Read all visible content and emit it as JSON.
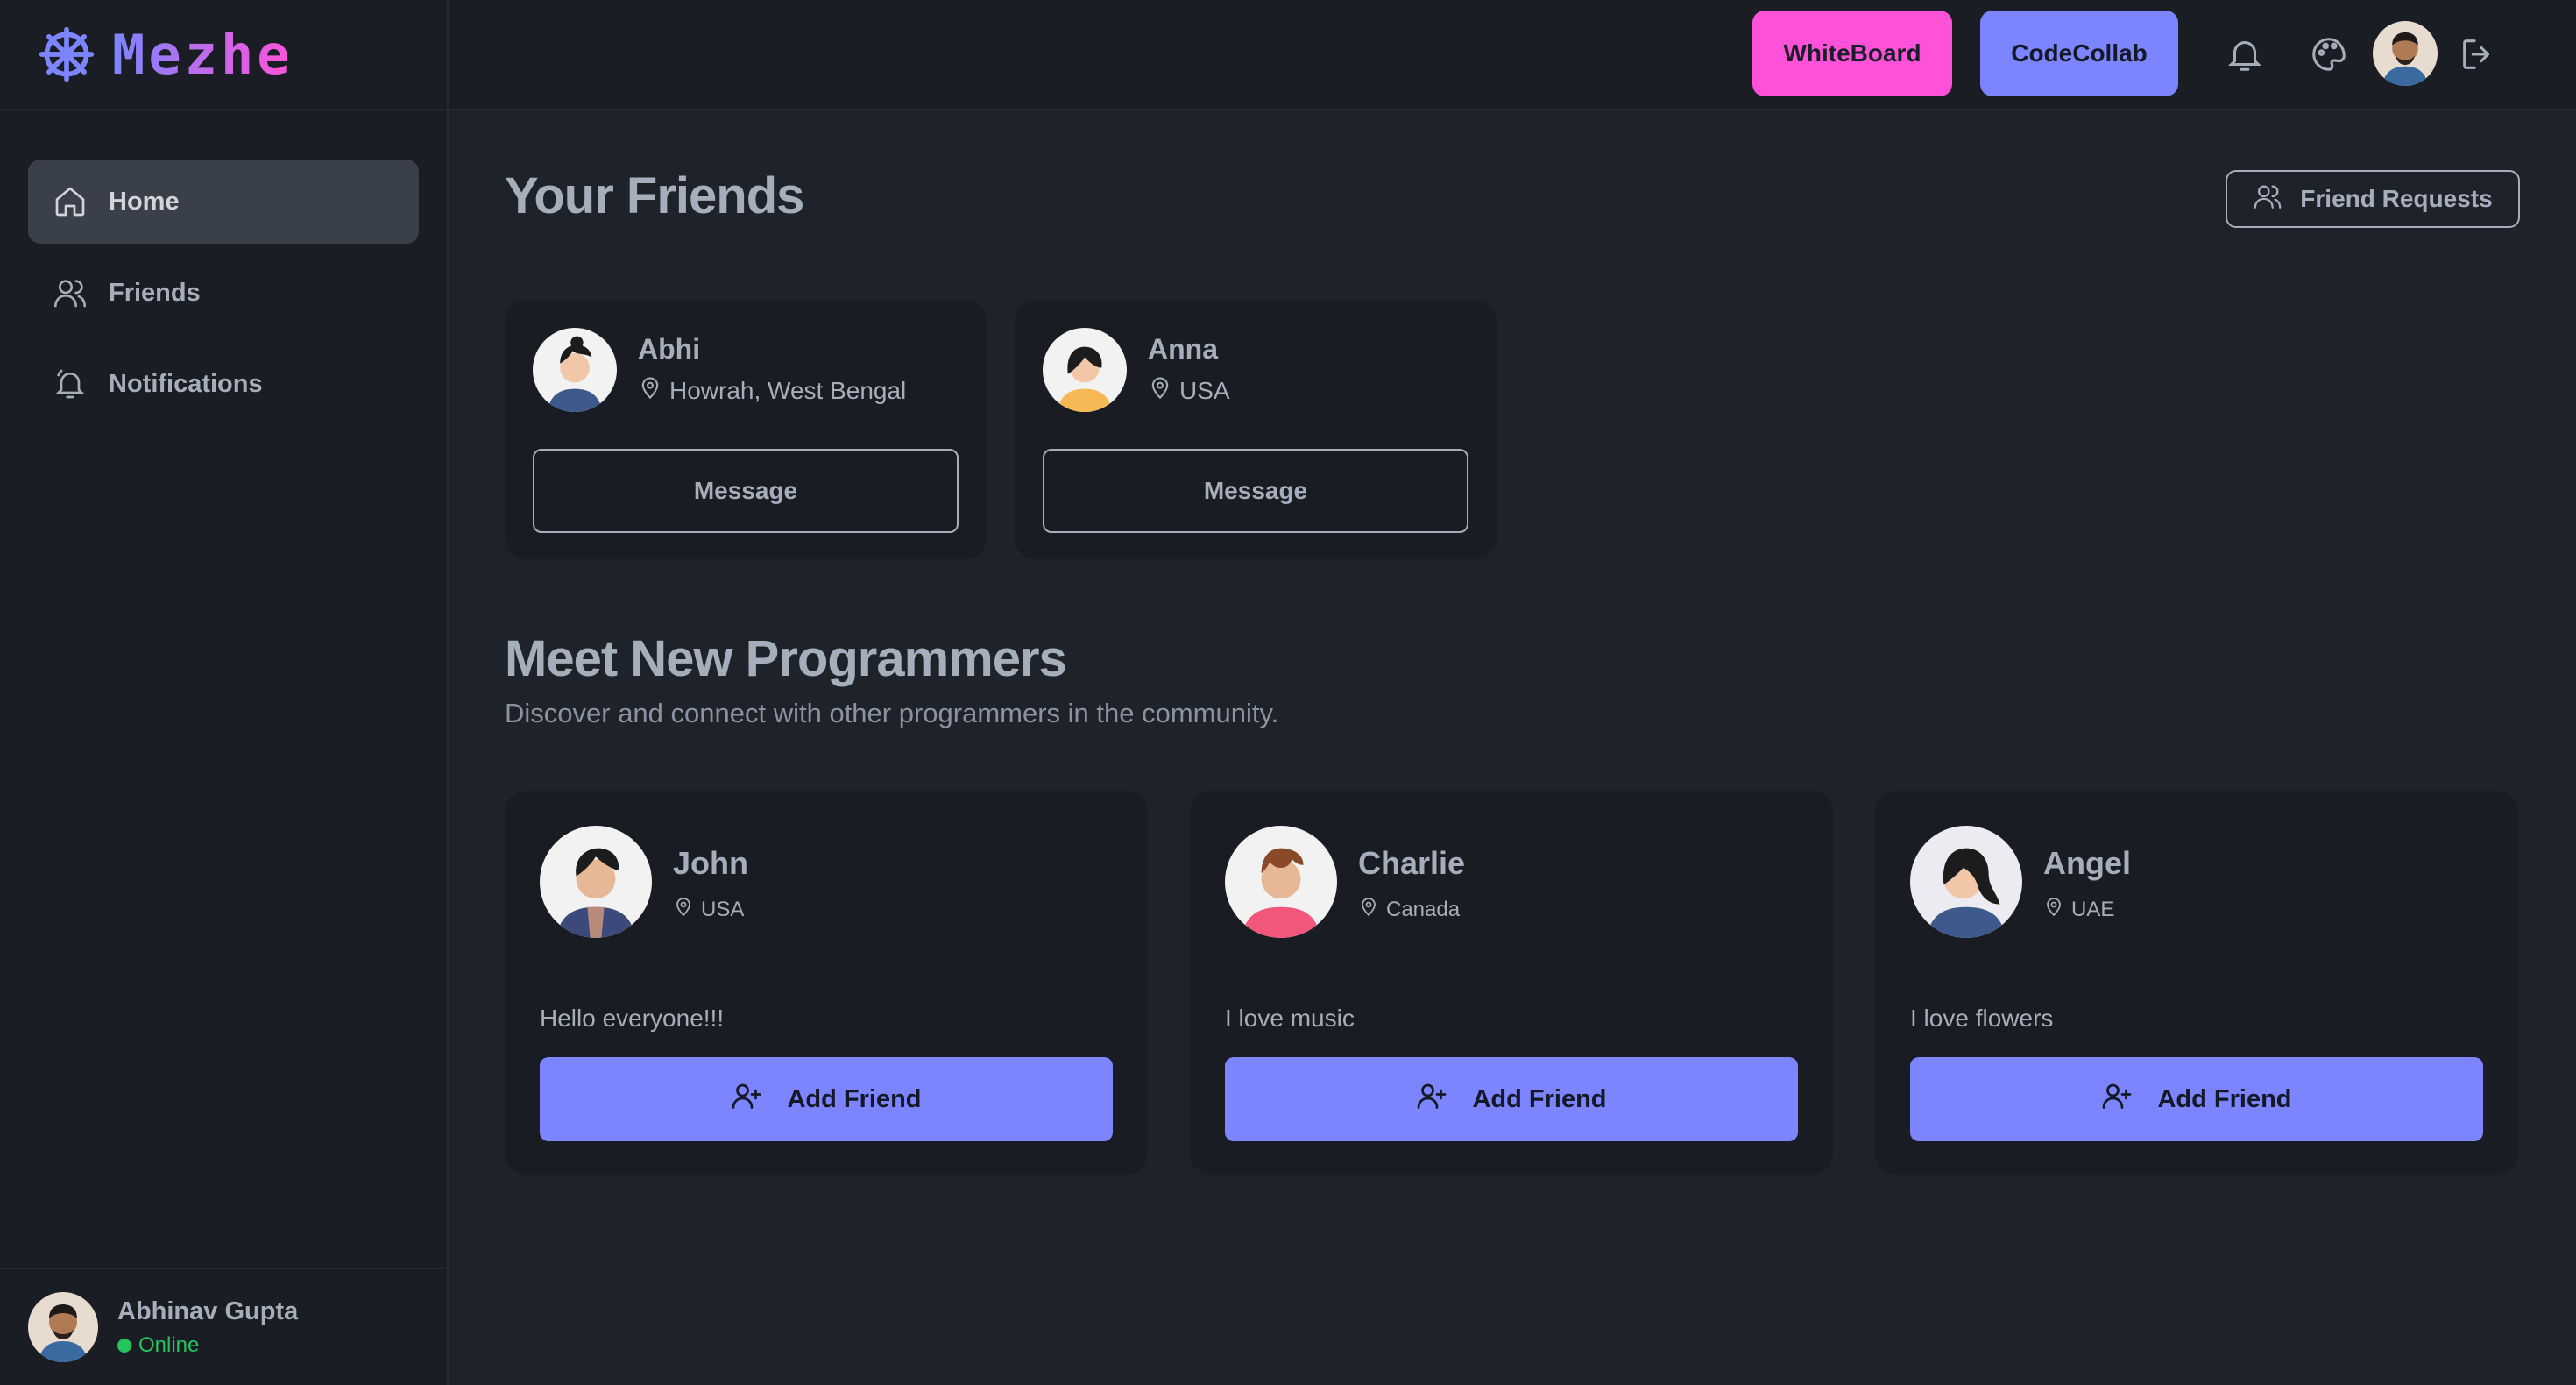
{
  "brand": {
    "name": "Mezhe",
    "logo_icon": "ship-wheel-icon",
    "gradient": [
      "#7c85ff",
      "#ff52d9"
    ]
  },
  "sidebar": {
    "items": [
      {
        "label": "Home",
        "icon": "home-icon",
        "active": true
      },
      {
        "label": "Friends",
        "icon": "users-icon",
        "active": false
      },
      {
        "label": "Notifications",
        "icon": "bell-icon",
        "active": false
      }
    ],
    "user": {
      "name": "Abhinav Gupta",
      "status": "Online"
    }
  },
  "topbar": {
    "whiteboard_label": "WhiteBoard",
    "codecollab_label": "CodeCollab",
    "icons": [
      "bell-icon",
      "palette-icon",
      "logout-icon"
    ]
  },
  "friends_section": {
    "title": "Your Friends",
    "requests_label": "Friend Requests",
    "friends": [
      {
        "name": "Abhi",
        "location": "Howrah, West Bengal",
        "button": "Message"
      },
      {
        "name": "Anna",
        "location": "USA",
        "button": "Message"
      }
    ]
  },
  "programmers_section": {
    "title": "Meet New Programmers",
    "subtitle": "Discover and connect with other programmers in the community.",
    "people": [
      {
        "name": "John",
        "location": "USA",
        "bio": "Hello everyone!!!",
        "button": "Add Friend"
      },
      {
        "name": "Charlie",
        "location": "Canada",
        "bio": "I love music",
        "button": "Add Friend"
      },
      {
        "name": "Angel",
        "location": "UAE",
        "bio": "I love flowers",
        "button": "Add Friend"
      }
    ]
  },
  "colors": {
    "background": "#1e232b",
    "sidebar": "#1a1e24",
    "card": "#191d23",
    "primary": "#7c85ff",
    "secondary": "#ff52d9",
    "online": "#22c55e"
  }
}
